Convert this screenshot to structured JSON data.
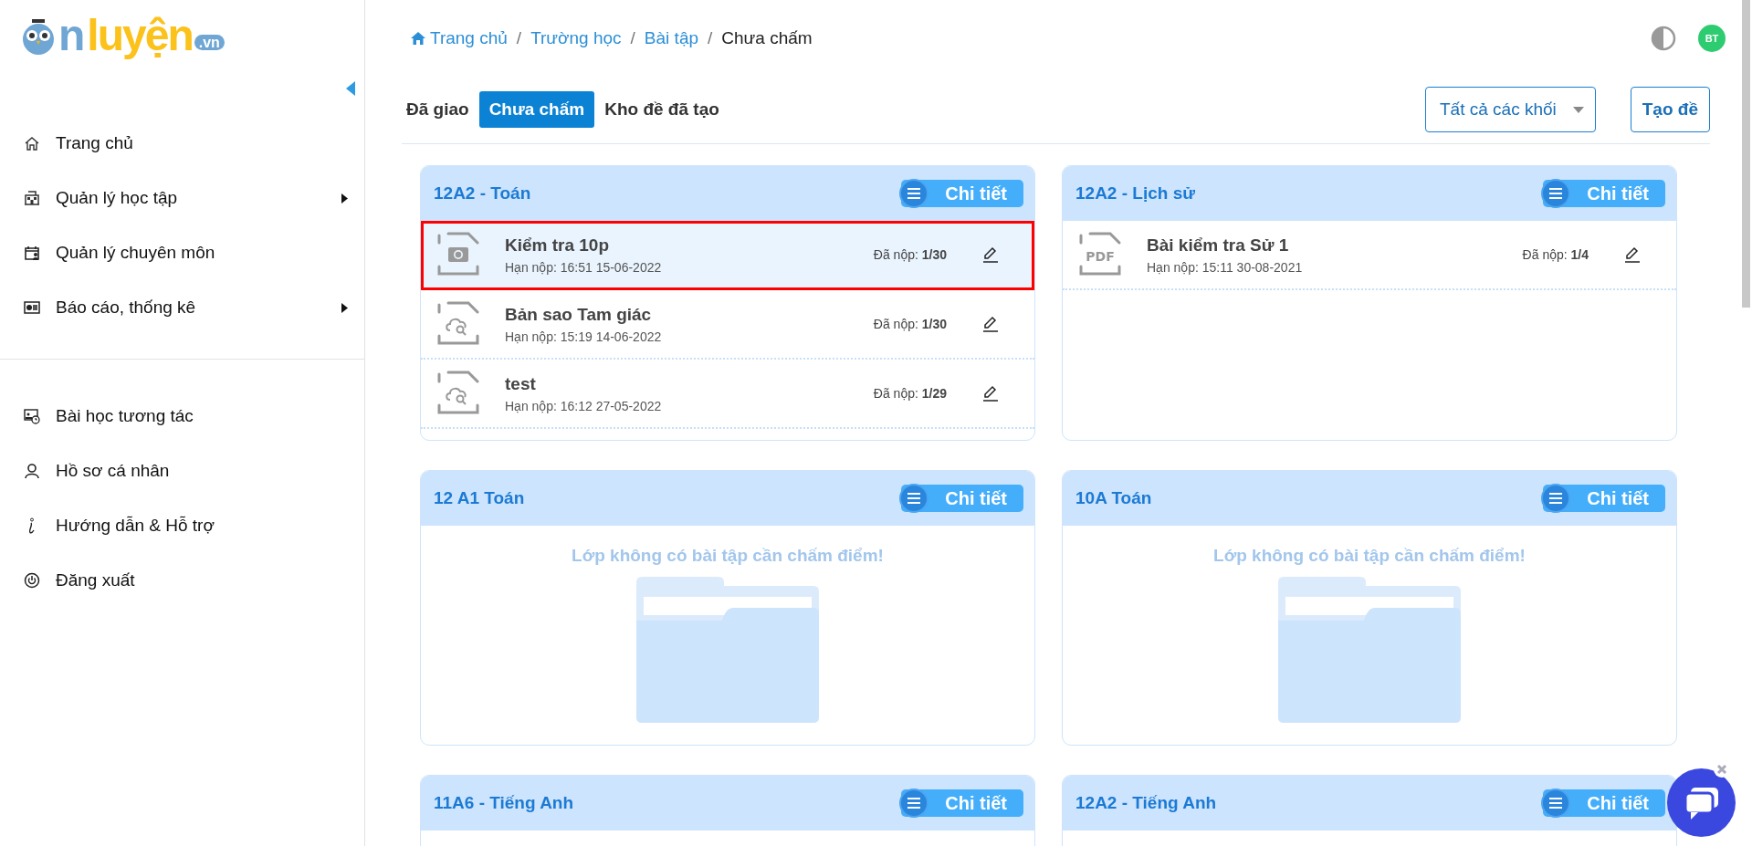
{
  "logo": {
    "parts": [
      "n",
      "luyện",
      ".vn"
    ]
  },
  "sidebar": {
    "items": [
      {
        "label": "Trang chủ",
        "submenu": false
      },
      {
        "label": "Quản lý học tập",
        "submenu": true
      },
      {
        "label": "Quản lý chuyên môn",
        "submenu": false
      },
      {
        "label": "Báo cáo, thống kê",
        "submenu": true
      }
    ],
    "items_secondary": [
      {
        "label": "Bài học tương tác"
      },
      {
        "label": "Hồ sơ cá nhân"
      },
      {
        "label": "Hướng dẫn & Hỗ trợ"
      },
      {
        "label": "Đăng xuất"
      }
    ]
  },
  "breadcrumb": [
    {
      "label": "Trang chủ",
      "current": false
    },
    {
      "label": "Trường học",
      "current": false
    },
    {
      "label": "Bài tập",
      "current": false
    },
    {
      "label": "Chưa chấm",
      "current": true
    }
  ],
  "breadcrumb_separator": "/",
  "avatar": {
    "initials": "BT"
  },
  "tabs": [
    {
      "label": "Đã giao",
      "selected": false
    },
    {
      "label": "Chưa chấm",
      "selected": true
    },
    {
      "label": "Kho đề đã tạo",
      "selected": false
    }
  ],
  "grade_filter": {
    "value": "Tất cả các khối"
  },
  "create_button": "Tạo đề",
  "classes": [
    {
      "title": "12A2 - Toán",
      "detail": "Chi tiết",
      "assignments": [
        {
          "kind": "camera",
          "title": "Kiểm tra 10p",
          "deadline": "Hạn nộp: 16:51 15-06-2022",
          "submitted": "Đã nộp: **1/30**",
          "highlighted": true
        },
        {
          "kind": "cloud",
          "title": "Bản sao Tam giác",
          "deadline": "Hạn nộp: 15:19 14-06-2022",
          "submitted": "Đã nộp: **1/30**",
          "highlighted": false
        },
        {
          "kind": "cloud",
          "title": "test",
          "deadline": "Hạn nộp: 16:12 27-05-2022",
          "submitted": "Đã nộp: **1/29**",
          "highlighted": false
        }
      ]
    },
    {
      "title": "12A2 - Lịch sử",
      "detail": "Chi tiết",
      "assignments": [
        {
          "kind": "pdf",
          "icon_text": "PDF",
          "title": "Bài kiểm tra Sử 1",
          "deadline": "Hạn nộp: 15:11 30-08-2021",
          "submitted": "Đã nộp: **1/4**",
          "highlighted": false
        }
      ]
    },
    {
      "title": "12 A1 Toán",
      "detail": "Chi tiết",
      "empty_message": "Lớp không có bài tập cần chấm điểm!"
    },
    {
      "title": "10A Toán",
      "detail": "Chi tiết",
      "empty_message": "Lớp không có bài tập cần chấm điểm!"
    },
    {
      "title": "11A6 - Tiếng Anh",
      "detail": "Chi tiết"
    },
    {
      "title": "12A2 - Tiếng Anh",
      "detail": "Chi tiết"
    }
  ]
}
